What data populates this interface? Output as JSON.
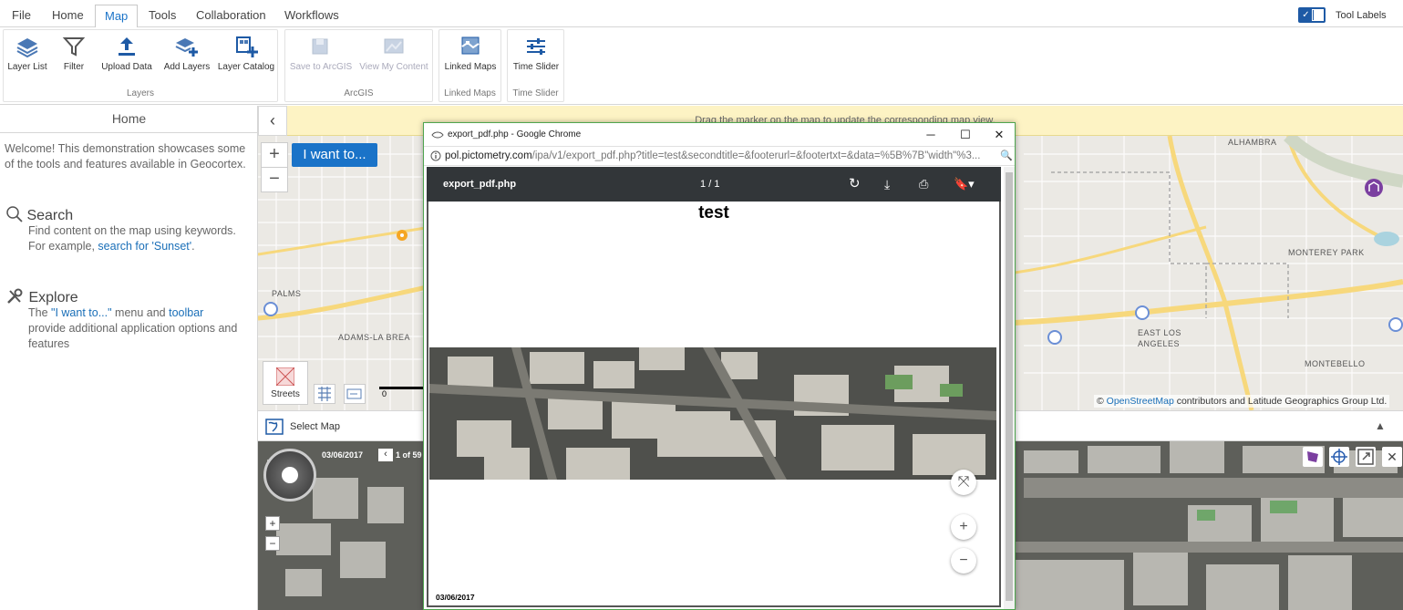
{
  "menu": {
    "tabs": [
      "File",
      "Home",
      "Map",
      "Tools",
      "Collaboration",
      "Workflows"
    ],
    "active": "Map",
    "tool_labels": "Tool Labels",
    "toggle_checked": true
  },
  "ribbon": {
    "groups": [
      {
        "title": "Layers",
        "buttons": [
          "Layer List",
          "Filter",
          "Upload Data",
          "Add Layers",
          "Layer Catalog"
        ]
      },
      {
        "title": "ArcGIS",
        "buttons": [
          "Save to ArcGIS",
          "View My Content"
        ]
      },
      {
        "title": "Linked Maps",
        "buttons": [
          "Linked Maps"
        ]
      },
      {
        "title": "Time Slider",
        "buttons": [
          "Time Slider"
        ]
      }
    ]
  },
  "left_panel": {
    "title": "Home",
    "welcome": "Welcome! This demonstration showcases some of the tools and features available in Geocortex.",
    "search_title": "Search",
    "search_text_1": "Find content on the map using keywords.",
    "search_text_2": "For example, ",
    "search_link": "search for 'Sunset'",
    "search_text_end": ".",
    "explore_title": "Explore",
    "explore_text_1": "The ",
    "explore_link_1": "\"I want to...\"",
    "explore_text_2": " menu and ",
    "explore_link_2": "toolbar",
    "explore_text_3": "provide additional application options and features"
  },
  "map": {
    "banner": "Drag the marker on the map to update the corresponding map view.",
    "i_want_to": "I want to...",
    "basemap_label": "Streets",
    "scale_text": "0",
    "attribution_link": "OpenStreetMap",
    "attribution_text": " contributors and Latitude Geographics Group Ltd.",
    "places": [
      "PALMS",
      "ADAMS-LA BREA",
      "ALHAMBRA",
      "MONTEREY PARK",
      "EAST LOS ANGELES",
      "MONTEBELLO"
    ],
    "select_map": "Select Map"
  },
  "oblique": {
    "date": "03/06/2017",
    "counter": "1 of 59"
  },
  "chrome": {
    "window_title": "export_pdf.php - Google Chrome",
    "url_domain": "pol.pictometry.com",
    "url_path": "/ipa/v1/export_pdf.php?title=test&secondtitle=&footerurl=&footertxt=&data=%5B%7B\"width\"%3...",
    "pdf_filename": "export_pdf.php",
    "page_current": "1",
    "page_sep": "/",
    "page_total": "1",
    "doc_title": "test",
    "doc_date": "03/06/2017"
  },
  "colors": {
    "accent": "#1a73c8",
    "banner": "#fdf3c4",
    "pdf_toolbar": "#323639",
    "window_border": "#4fa54f"
  }
}
